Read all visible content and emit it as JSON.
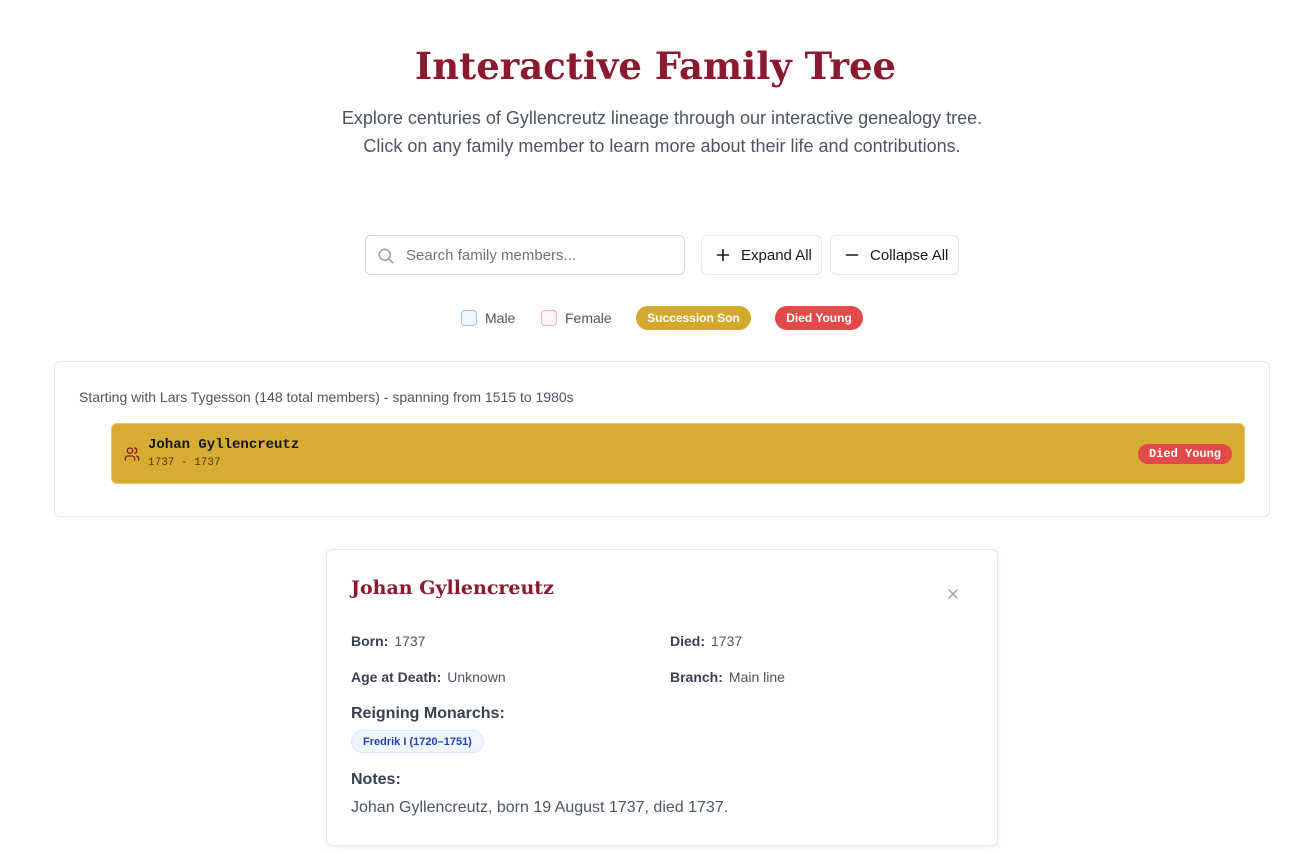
{
  "header": {
    "title": "Interactive Family Tree",
    "subtitle": "Explore centuries of Gyllencreutz lineage through our interactive genealogy tree. Click on any family member to learn more about their life and contributions."
  },
  "controls": {
    "search_placeholder": "Search family members...",
    "expand_label": "Expand All",
    "collapse_label": "Collapse All"
  },
  "legend": {
    "male": "Male",
    "female": "Female",
    "succession_son": "Succession Son",
    "died_young": "Died Young",
    "colors": {
      "succession": "#d4a82c",
      "died_young": "#e24a4a",
      "male_border": "#93c5fd",
      "female_border": "#f9a8d4"
    }
  },
  "tree": {
    "summary": "Starting with Lars Tygesson (148 total members) - spanning from 1515 to 1980s",
    "members": [
      {
        "name": "Johan Gyllencreutz",
        "dates": "1737 - 1737",
        "badge": "Died Young",
        "icon": "users-icon"
      }
    ]
  },
  "detail": {
    "name": "Johan Gyllencreutz",
    "born_label": "Born:",
    "born": "1737",
    "died_label": "Died:",
    "died": "1737",
    "age_label": "Age at Death:",
    "age": "Unknown",
    "branch_label": "Branch:",
    "branch": "Main line",
    "monarchs_label": "Reigning Monarchs:",
    "monarchs": [
      "Fredrik I (1720–1751)"
    ],
    "notes_label": "Notes:",
    "notes": "Johan Gyllencreutz, born 19 August 1737, died 1737."
  }
}
